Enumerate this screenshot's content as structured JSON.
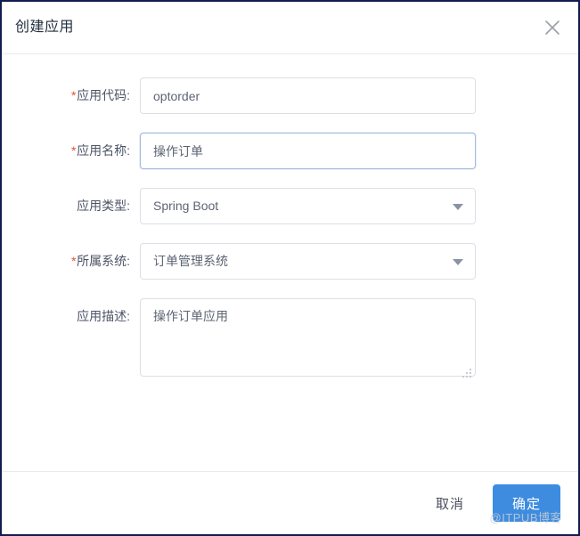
{
  "dialog": {
    "title": "创建应用",
    "close_icon": "close-icon"
  },
  "form": {
    "fields": [
      {
        "label": "应用代码",
        "colon": ":",
        "required": true,
        "type": "text",
        "value": "optorder",
        "placeholder": "",
        "focused": false
      },
      {
        "label": "应用名称",
        "colon": ":",
        "required": true,
        "type": "text",
        "value": "操作订单",
        "placeholder": "",
        "focused": true
      },
      {
        "label": "应用类型",
        "colon": ":",
        "required": false,
        "type": "select",
        "value": "Spring Boot",
        "caret_icon": "chevron-down-icon"
      },
      {
        "label": "所属系统",
        "colon": ":",
        "required": true,
        "type": "select",
        "value": "订单管理系统",
        "caret_icon": "chevron-down-icon"
      },
      {
        "label": "应用描述",
        "colon": ":",
        "required": false,
        "type": "textarea",
        "value": "操作订单应用",
        "placeholder": "",
        "resize_icon": "resize-grip-icon"
      }
    ],
    "required_marker": "*"
  },
  "footer": {
    "cancel_label": "取消",
    "confirm_label": "确定"
  },
  "watermark": {
    "text": "@ITPUB博客"
  },
  "colors": {
    "primary": "#3d8ce0",
    "required_star": "#e8502f",
    "focus_border": "#a3bdde",
    "border": "#dcdfe6",
    "title_text": "#1f2d3d",
    "label_text": "#4c5567",
    "input_text": "#5d6573",
    "window_border": "#131c4e"
  }
}
